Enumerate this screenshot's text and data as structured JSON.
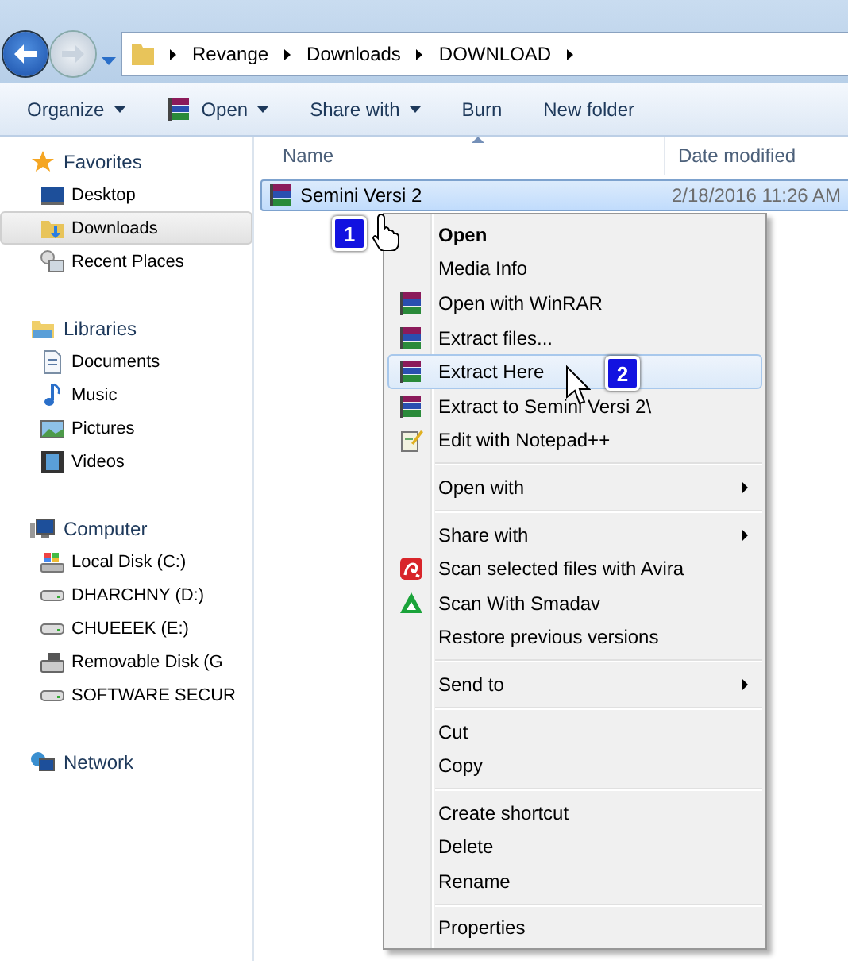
{
  "address_bar": {
    "crumbs": [
      "Revange",
      "Downloads",
      "DOWNLOAD"
    ]
  },
  "toolbar": [
    {
      "label": "Organize",
      "kind": "dropdown"
    },
    {
      "label": "Open",
      "kind": "winrar-dropdown"
    },
    {
      "label": "Share with",
      "kind": "dropdown"
    },
    {
      "label": "Burn",
      "kind": "plain"
    },
    {
      "label": "New folder",
      "kind": "plain"
    }
  ],
  "sidebar": {
    "groups": [
      {
        "label": "Favorites",
        "kind": "star",
        "children": [
          {
            "label": "Desktop",
            "kind": "desktop",
            "selected": false
          },
          {
            "label": "Downloads",
            "kind": "downloads",
            "selected": true
          },
          {
            "label": "Recent Places",
            "kind": "recent",
            "selected": false
          }
        ]
      },
      {
        "label": "Libraries",
        "kind": "library",
        "children": [
          {
            "label": "Documents",
            "kind": "document",
            "selected": false
          },
          {
            "label": "Music",
            "kind": "music",
            "selected": false
          },
          {
            "label": "Pictures",
            "kind": "pictures",
            "selected": false
          },
          {
            "label": "Videos",
            "kind": "videos",
            "selected": false
          }
        ]
      },
      {
        "label": "Computer",
        "kind": "computer",
        "children": [
          {
            "label": "Local Disk (C:)",
            "kind": "system-drive",
            "selected": false
          },
          {
            "label": "DHARCHNY (D:)",
            "kind": "drive",
            "selected": false
          },
          {
            "label": "CHUEEEK (E:)",
            "kind": "drive",
            "selected": false
          },
          {
            "label": "Removable Disk (G",
            "kind": "removable",
            "selected": false
          },
          {
            "label": "SOFTWARE SECUR",
            "kind": "drive",
            "selected": false
          }
        ]
      },
      {
        "label": "Network",
        "kind": "network"
      }
    ]
  },
  "file_list": {
    "columns": [
      "Name",
      "Date modified"
    ],
    "rows": [
      {
        "name": "Semini Versi 2",
        "date": "2/18/2016 11:26 AM",
        "selected": true
      }
    ]
  },
  "context_menu": {
    "groups": [
      [
        {
          "label": "Open",
          "kind": "plain",
          "default": true,
          "selected": false
        },
        {
          "label": "Media Info",
          "kind": "plain",
          "default": false,
          "selected": false
        },
        {
          "label": "Open with WinRAR",
          "kind": "winrar",
          "default": false,
          "selected": false
        },
        {
          "label": "Extract files...",
          "kind": "winrar",
          "default": false,
          "selected": false
        },
        {
          "label": "Extract Here",
          "kind": "winrar",
          "default": false,
          "selected": true
        },
        {
          "label": "Extract to Semini Versi 2\\",
          "kind": "winrar",
          "default": false,
          "selected": false
        },
        {
          "label": "Edit with Notepad++",
          "kind": "notepad",
          "default": false,
          "selected": false
        }
      ],
      [
        {
          "label": "Open with",
          "kind": "submenu",
          "default": false,
          "selected": false
        }
      ],
      [
        {
          "label": "Share with",
          "kind": "submenu",
          "default": false,
          "selected": false
        },
        {
          "label": "Scan selected files with Avira",
          "kind": "avira",
          "default": false,
          "selected": false
        },
        {
          "label": "Scan With Smadav",
          "kind": "smadav",
          "default": false,
          "selected": false
        },
        {
          "label": "Restore previous versions",
          "kind": "plain",
          "default": false,
          "selected": false
        }
      ],
      [
        {
          "label": "Send to",
          "kind": "submenu",
          "default": false,
          "selected": false
        }
      ],
      [
        {
          "label": "Cut",
          "kind": "plain",
          "default": false,
          "selected": false
        },
        {
          "label": "Copy",
          "kind": "plain",
          "default": false,
          "selected": false
        }
      ],
      [
        {
          "label": "Create shortcut",
          "kind": "plain",
          "default": false,
          "selected": false
        },
        {
          "label": "Delete",
          "kind": "plain",
          "default": false,
          "selected": false
        },
        {
          "label": "Rename",
          "kind": "plain",
          "default": false,
          "selected": false
        }
      ],
      [
        {
          "label": "Properties",
          "kind": "plain",
          "default": false,
          "selected": false
        }
      ]
    ]
  },
  "step_badges": [
    "1",
    "2"
  ]
}
